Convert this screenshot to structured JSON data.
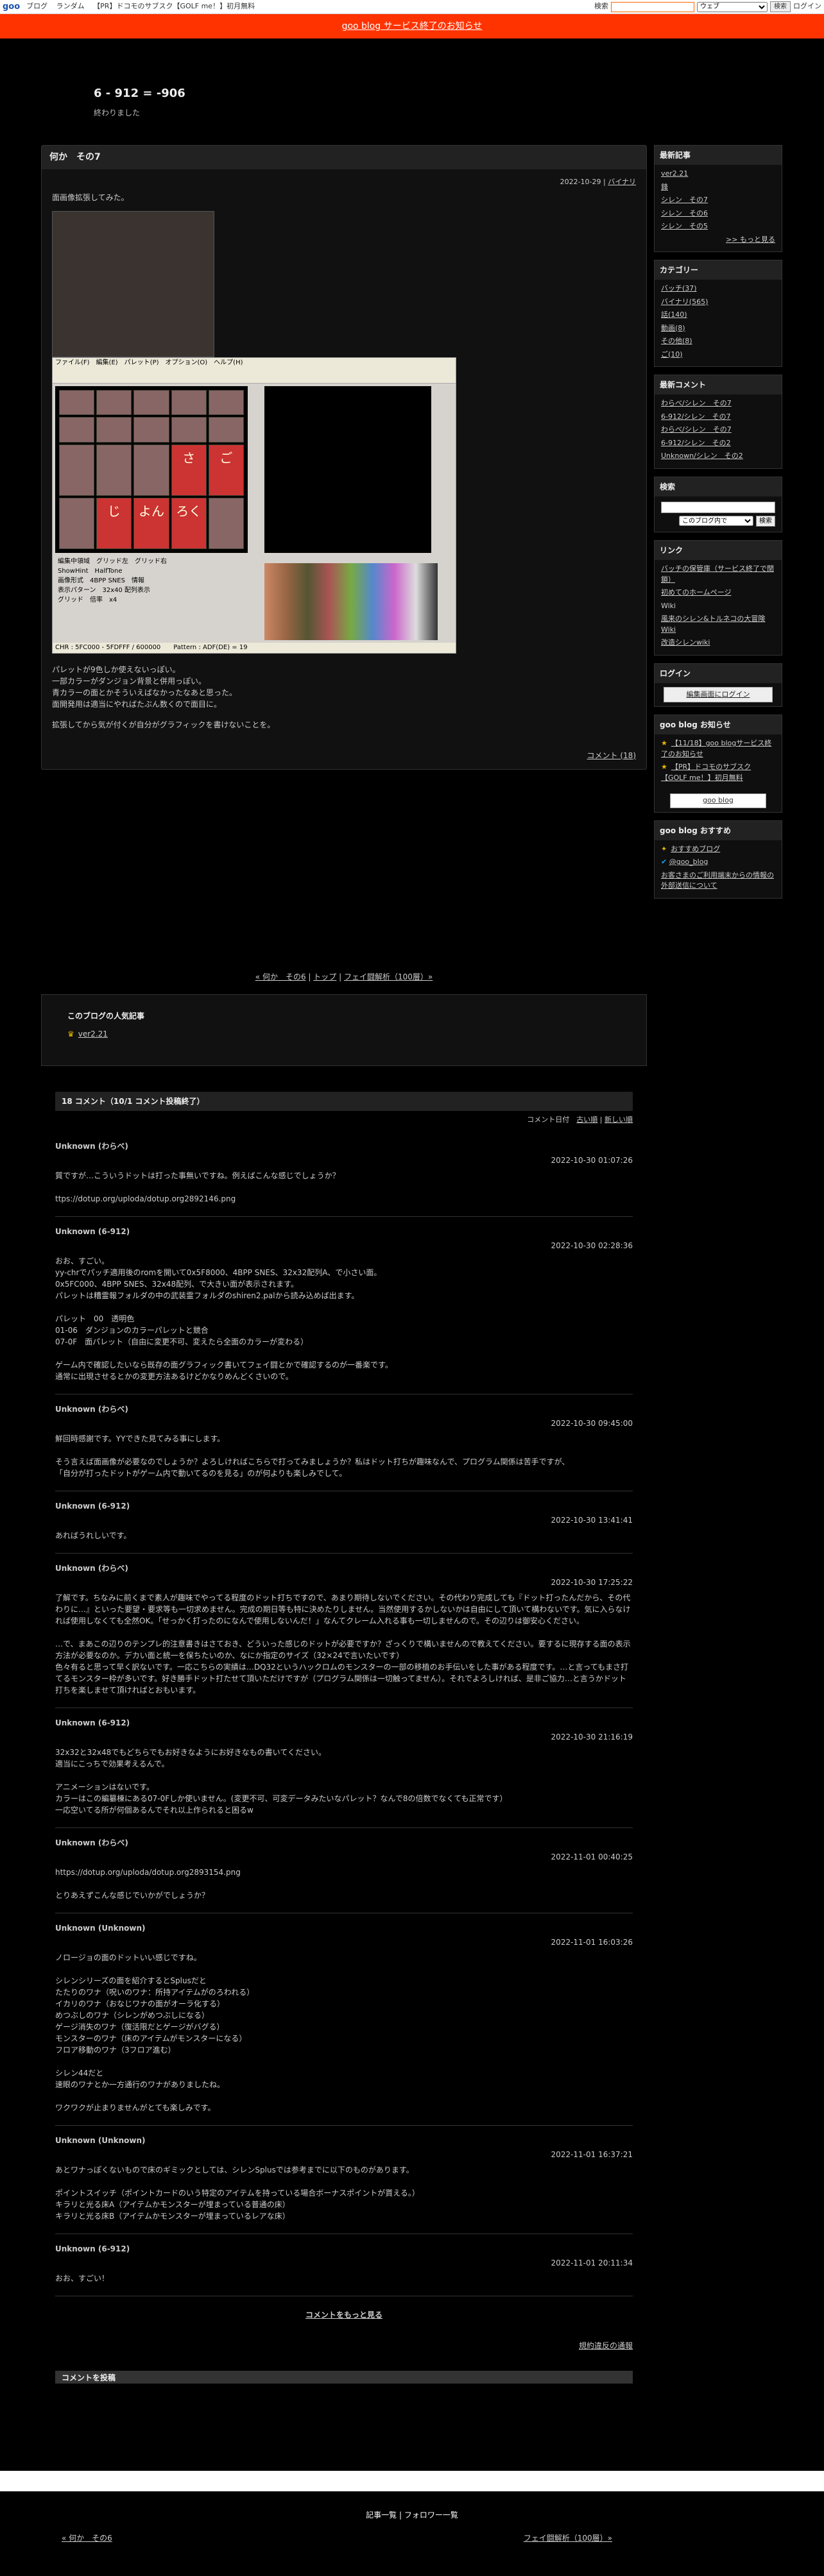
{
  "topbar": {
    "logo": "goo",
    "links": [
      "ブログ",
      "ランダム",
      "【PR】ドコモのサブスク【GOLF me！】初月無料"
    ],
    "search_label": "検索",
    "search_placeholder": "",
    "select": "ウェブ",
    "search_button": "検索",
    "login": "ログイン"
  },
  "notice": "goo blog サービス終了のお知らせ",
  "blog": {
    "title": "6 - 912 = -906",
    "description": "終わりました"
  },
  "entry": {
    "title": "何か　その7",
    "date": "2022-10-29",
    "category": "バイナリ",
    "intro": "面画像拡張してみた。",
    "editor_menu": "ファイル(F)　編集(E)　パレット(P)　オプション(O)　ヘルプ(H)",
    "editor_tiles": [
      "さ",
      "ご",
      "じ",
      "よん",
      "ろく"
    ],
    "editor_form": [
      "編集中領域",
      "グリッド左",
      "グリッド右",
      "ShowHint",
      "HalfTone",
      "画像形式",
      "4BPP SNES",
      "情報",
      "表示パターン",
      "32x40 配列表示",
      "グリッド",
      "倍率",
      "x4"
    ],
    "editor_status": "CHR : 5FC000 - 5FDFFF / 600000　　Pattern : ADF(DE) = 19",
    "paragraphs": [
      [
        "パレットが9色しか使えないっぽい。",
        "一部カラーがダンジョン背景と併用っぽい。",
        "青カラーの面とかそういえばなかったなあと思った。",
        "面開発用は適当にやればたぶん数くので面目に。"
      ],
      [
        "拡張してから気が付くが自分がグラフィックを書けないことを。"
      ]
    ],
    "comment_link": "コメント (18)"
  },
  "pager": {
    "prev": "« 何か　その6",
    "top": "トップ",
    "next": "フェイ闘解析（100層）»"
  },
  "popular": {
    "heading": "このブログの人気記事",
    "item": "ver2.21"
  },
  "comments": {
    "header": "18 コメント（10/1 コメント投稿終了）",
    "sort_label": "コメント日付",
    "sort_old": "古い順",
    "sort_new": "新しい順",
    "items": [
      {
        "name": "Unknown (わらべ)",
        "date": "2022-10-30 01:07:26",
        "lines": [
          "質ですが…こういうドットは打った事無いですね。例えばこんな感じでしょうか？",
          "",
          "ttps://dotup.org/uploda/dotup.org2892146.png"
        ]
      },
      {
        "name": "Unknown (6-912)",
        "date": "2022-10-30 02:28:36",
        "lines": [
          "おお、すごい。",
          "yy-chrでパッチ適用後のromを開いて0x5F8000、4BPP SNES、32x32配列A、で小さい面。",
          "0x5FC000、4BPP SNES、32x48配列、で大きい面が表示されます。",
          "パレットは糟霊報フォルダの中の武装霊フォルダのshiren2.palから読み込めば出ます。",
          "",
          "パレット　00　透明色",
          "01-06　ダンジョンのカラーパレットと競合",
          "07-0F　面パレット（自由に変更不可、変えたら全面のカラーが変わる）",
          "",
          "ゲーム内で確認したいなら既存の面グラフィック書いてフェイ闘とかで確認するのが一番楽です。",
          "通常に出現させるとかの変更方法あるけどかなりめんどくさいので。"
        ]
      },
      {
        "name": "Unknown (わらべ)",
        "date": "2022-10-30 09:45:00",
        "lines": [
          "鮮回時感謝です。YYできた見てみる事にします。",
          "",
          "そう言えば面画像が必要なのでしょうか？よろしければこちらで打ってみましょうか？私はドット打ちが趣味なんで、プログラム関係は苦手ですが、",
          "「自分が打ったドットがゲーム内で動いてるのを見る」のが何よりも楽しみでして。"
        ]
      },
      {
        "name": "Unknown (6-912)",
        "date": "2022-10-30 13:41:41",
        "lines": [
          "あればうれしいです。"
        ]
      },
      {
        "name": "Unknown (わらべ)",
        "date": "2022-10-30 17:25:22",
        "lines": [
          "了解です。ちなみに前くまで素人が趣味でやってる程度のドット打ちですので、あまり期待しないでください。その代わり完成しても『ドット打ったんだから、その代わりに…』といった要望・要求等も一切求めません。完成の期日等も特に決めたりしません。当然使用するかしないかは自由にして頂いて構わないです。気に入らなければ使用しなくても全然OK。「せっかく打ったのになんで使用しないんだ！」なんてクレーム入れる事も一切しませんので。その辺りは御安心ください。",
          "",
          "…で、まあこの辺りのテンプレ的注意書きはさておき、どういった感じのドットが必要ですか？ざっくりで構いませんので教えてください。要するに現存する面の表示方法が必要なのか。デカい面と統一を保ちたいのか、なにか指定のサイズ（32×24で言いたいです）",
          "色々有ると思って早く訳ないです。一応こちらの実績は…DQ32というハックロムのモンスターの一部の移植のお手伝いをした事がある程度です。…と言ってもまさ打てるモンスター枠が多いです。好き勝手ドット打たせて頂いただけですが（プログラム関係は一切触ってません）。それでよろしければ、是非ご協力…と言うかドット打ちを楽しませて頂ければとおもいます。"
        ]
      },
      {
        "name": "Unknown (6-912)",
        "date": "2022-10-30 21:16:19",
        "lines": [
          "32x32と32x48でもどちらでもお好きなようにお好きなもの書いてください。",
          "適当にこっちで効果考えるんで。",
          "",
          "アニメーションはないです。",
          "カラーはこの編纂棟にある07-0Fしか使いません。(変更不可、可変データみたいなパレット？なんで8の倍数でなくても正常です）",
          "一応空いてる所が何個あるんでそれ以上作られると困るw"
        ]
      },
      {
        "name": "Unknown (わらべ)",
        "date": "2022-11-01 00:40:25",
        "lines": [
          "https://dotup.org/uploda/dotup.org2893154.png",
          "",
          "とりあえずこんな感じでいかがでしょうか？"
        ]
      },
      {
        "name": "Unknown (Unknown)",
        "date": "2022-11-01 16:03:26",
        "lines": [
          "ノロージョの面のドットいい感じですね。",
          "",
          "シレンシリーズの面を紹介するとSplusだと",
          "たたりのワナ（呪いのワナ：所持アイテムがのろわれる）",
          "イカリのワナ（おなじワナの面がオーラ化する）",
          "めつぶしのワナ（シレンがめつぶしになる）",
          "ゲージ消失のワナ（復活限だとゲージがバグる）",
          "モンスターのワナ（床のアイテムがモンスターになる）",
          "フロア移動のワナ（3フロア進む）",
          "",
          "シレン44だと",
          "速眼のワナとか一方通行のワナがありましたね。",
          "",
          "ワクワクが止まりませんがとても楽しみです。"
        ]
      },
      {
        "name": "Unknown (Unknown)",
        "date": "2022-11-01 16:37:21",
        "lines": [
          "あとワナっぽくないもので床のギミックとしては、シレンSplusでは参考までに以下のものがあります。",
          "",
          "ポイントスイッチ（ポイントカードのいう特定のアイテムを持っている場合ボーナスポイントが貰える。）",
          "キラリと光る床A（アイテムかモンスターが埋まっている普通の床）",
          "キラリと光る床B（アイテムかモンスターが埋まっているレアな床）"
        ]
      },
      {
        "name": "Unknown (6-912)",
        "date": "2022-11-01 20:11:34",
        "lines": [
          "おお、すごい！"
        ]
      }
    ],
    "more": "コメントをもっと見る",
    "rules": "規約違反の通報",
    "post_header": "コメントを投稿"
  },
  "sidebar": {
    "recent": {
      "title": "最新記事",
      "items": [
        "ver2.21",
        "鋒",
        "シレン　その7",
        "シレン　その6",
        "シレン　その5"
      ],
      "more": ">> もっと見る"
    },
    "category": {
      "title": "カテゴリー",
      "items": [
        "バッチ(37)",
        "バイナリ(565)",
        "話(140)",
        "動画(8)",
        "その他(8)",
        "ご(10)"
      ]
    },
    "recent_comments": {
      "title": "最新コメント",
      "items": [
        "わらべ/シレン　その7",
        "6-912/シレン　その7",
        "わらべ/シレン　その7",
        "6-912/シレン　その2",
        "Unknown/シレン　その2"
      ]
    },
    "search": {
      "title": "検索",
      "select": "このブログ内で",
      "button": "検索"
    },
    "links": {
      "title": "リンク",
      "items": [
        "バッチの保管庫（サービス終了で閉鎖）",
        "初めてのホームページ",
        "",
        "Wiki",
        "風来のシレン&トルネコの大冒険 Wiki",
        "改造シレンwiki"
      ]
    },
    "login": {
      "title": "ログイン",
      "button": "編集画面にログイン"
    },
    "goo_notice": {
      "title": "goo blog お知らせ",
      "items": [
        "【11/18】goo blogサービス終了のお知らせ",
        "【PR】ドコモのサブスク【GOLF me！】初月無料"
      ],
      "badge": "goo blog"
    },
    "goo_recommend": {
      "title": "goo blog おすすめ",
      "items": [
        "おすすめブログ",
        "@goo_blog"
      ],
      "report": "お客さまのご利用端末からの情報の外部送信について"
    }
  },
  "footer": {
    "links": "記事一覧 | フォロワー一覧",
    "prev": "« 何か　その6",
    "next": "フェイ闘解析（100層）»"
  },
  "colors": {
    "notice_bg": "#ff3300",
    "crown": "#e6b800",
    "accent": "#f60"
  }
}
